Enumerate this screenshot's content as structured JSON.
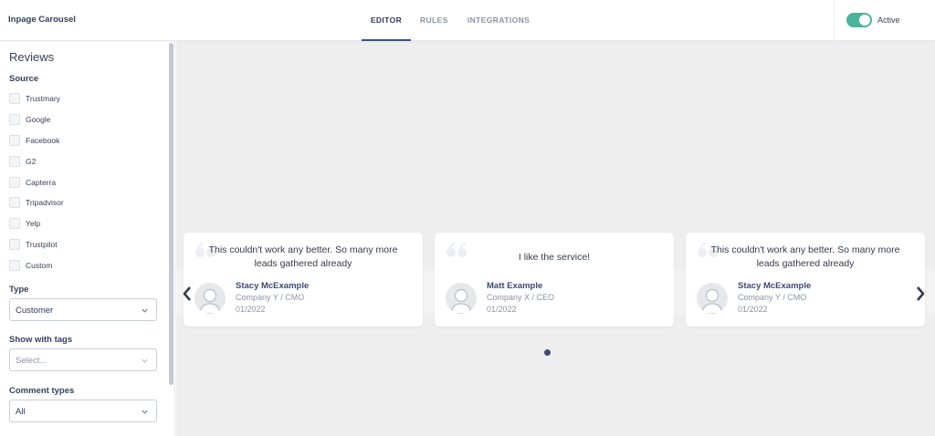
{
  "header": {
    "app_title": "Inpage Carousel",
    "tabs": [
      {
        "label": "EDITOR",
        "active": true
      },
      {
        "label": "RULES",
        "active": false
      },
      {
        "label": "INTEGRATIONS",
        "active": false
      }
    ],
    "status_label": "Active",
    "status_on": true,
    "toggle_color": "#4cb39a"
  },
  "sidebar": {
    "title": "Reviews",
    "source_label": "Source",
    "sources": [
      {
        "label": "Trustmary",
        "checked": false
      },
      {
        "label": "Google",
        "checked": false
      },
      {
        "label": "Facebook",
        "checked": false
      },
      {
        "label": "G2",
        "checked": false
      },
      {
        "label": "Capterra",
        "checked": false
      },
      {
        "label": "Tripadvisor",
        "checked": false
      },
      {
        "label": "Yelp",
        "checked": false
      },
      {
        "label": "Trustpilot",
        "checked": false
      },
      {
        "label": "Custom",
        "checked": false
      }
    ],
    "type_label": "Type",
    "type_value": "Customer",
    "tags_label": "Show with tags",
    "tags_placeholder": "Select...",
    "comment_types_label": "Comment types",
    "comment_types_value": "All"
  },
  "carousel": {
    "cards": [
      {
        "text": "This couldn't work any better. So many more leads gathered already",
        "name": "Stacy McExample",
        "company": "Company Y / CMO",
        "date": "01/2022"
      },
      {
        "text": "I like the service!",
        "name": "Matt Example",
        "company": "Company X / CEO",
        "date": "01/2022"
      },
      {
        "text": "This couldn't work any better. So many more leads gathered already",
        "name": "Stacy McExample",
        "company": "Company Y / CMO",
        "date": "01/2022"
      }
    ],
    "accent_color": "#3b4a72",
    "pages": 1,
    "current_page": 1
  }
}
